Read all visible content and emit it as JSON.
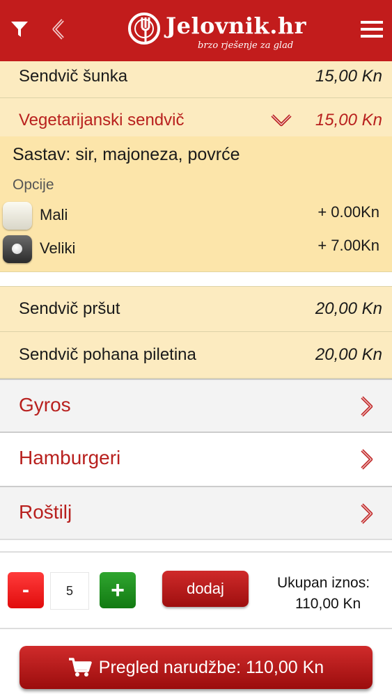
{
  "header": {
    "logo_title": "Jelovnik.hr",
    "logo_tagline": "brzo rješenje za glad",
    "icons": [
      "filter-icon",
      "back-chevron-icon",
      "menu-icon"
    ]
  },
  "items": [
    {
      "name": "Sendvič šunka",
      "price": "15,00 Kn"
    },
    {
      "name": "Vegetarijanski sendvič",
      "price": "15,00 Kn"
    },
    {
      "name": "Sendvič pršut",
      "price": "20,00 Kn"
    },
    {
      "name": "Sendvič pohana piletina",
      "price": "20,00 Kn"
    }
  ],
  "detail": {
    "sastav": "Sastav: sir, majoneza, povrće",
    "options_title": "Opcije",
    "options": [
      {
        "label": "Mali",
        "price": "+ 0.00Kn",
        "selected": false
      },
      {
        "label": "Veliki",
        "price": "+ 7.00Kn",
        "selected": true
      }
    ]
  },
  "categories": [
    {
      "label": "Gyros"
    },
    {
      "label": "Hamburgeri"
    },
    {
      "label": "Roštilj"
    }
  ],
  "order": {
    "minus_label": "-",
    "quantity": "5",
    "plus_label": "+",
    "add_label": "dodaj",
    "total_label": "Ukupan iznos:",
    "total_value": "110,00 Kn"
  },
  "review_button": "Pregled narudžbe: 110,00 Kn",
  "colors": {
    "brand_red": "#c21c1c",
    "row_bg": "#fcebc0",
    "detail_bg": "#fce5aa",
    "accent_text": "#b8201e",
    "plus_green": "#1b8c1b"
  }
}
